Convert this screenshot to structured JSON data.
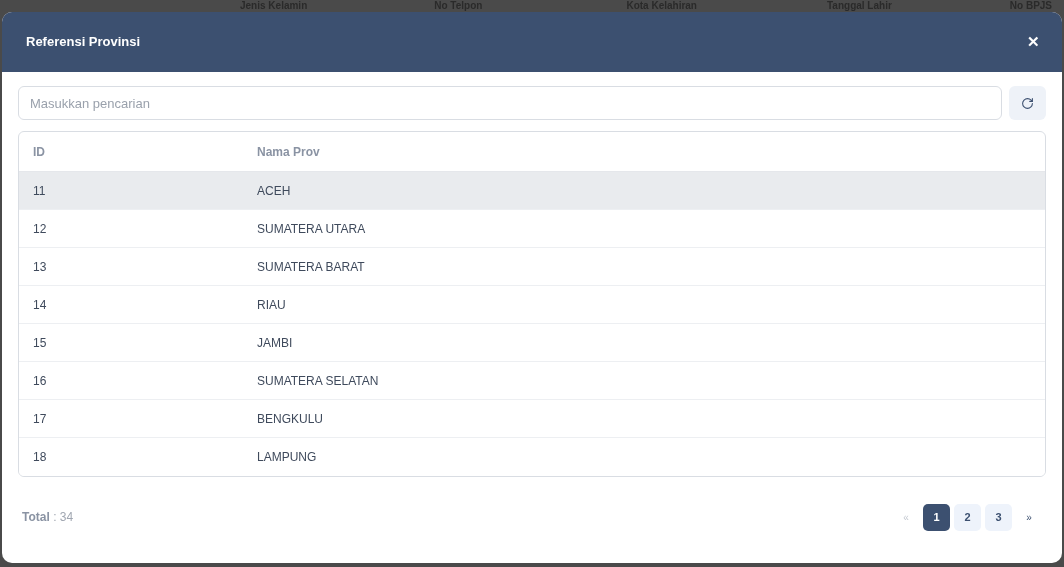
{
  "background_columns": [
    "Jenis Kelamin",
    "No Telpon",
    "Kota Kelahiran",
    "Tanggal Lahir",
    "No BPJS"
  ],
  "dialog": {
    "title": "Referensi Provinsi",
    "close": "✕"
  },
  "search": {
    "placeholder": "Masukkan pencarian"
  },
  "table": {
    "columns": [
      "ID",
      "Nama Prov"
    ],
    "rows": [
      {
        "id": "11",
        "name": "ACEH",
        "selected": true
      },
      {
        "id": "12",
        "name": "SUMATERA UTARA",
        "selected": false
      },
      {
        "id": "13",
        "name": "SUMATERA BARAT",
        "selected": false
      },
      {
        "id": "14",
        "name": "RIAU",
        "selected": false
      },
      {
        "id": "15",
        "name": "JAMBI",
        "selected": false
      },
      {
        "id": "16",
        "name": "SUMATERA SELATAN",
        "selected": false
      },
      {
        "id": "17",
        "name": "BENGKULU",
        "selected": false
      },
      {
        "id": "18",
        "name": "LAMPUNG",
        "selected": false
      }
    ]
  },
  "footer": {
    "total_label": "Total",
    "total_value": ": 34"
  },
  "pagination": {
    "prev": "«",
    "next": "»",
    "pages": [
      {
        "label": "1",
        "selected": true
      },
      {
        "label": "2",
        "selected": false
      },
      {
        "label": "3",
        "selected": false
      }
    ]
  }
}
